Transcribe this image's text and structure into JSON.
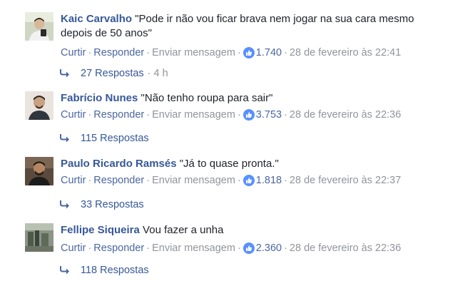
{
  "actions": {
    "like": "Curtir",
    "reply": "Responder",
    "message": "Enviar mensagem",
    "separator": "·"
  },
  "comments": [
    {
      "author": "Kaic Carvalho",
      "text_line1": "\"Pode ir não vou ficar brava nem jogar na sua cara mesmo",
      "text_line2": "depois de 50 anos\"",
      "likes": "1.740",
      "timestamp": "28 de fevereiro às 22:41",
      "replies": "27 Respostas",
      "reply_time": "· 4 h"
    },
    {
      "author": "Fabrício Nunes",
      "text_line1": "\"Não tenho roupa para sair\"",
      "likes": "3.753",
      "timestamp": "28 de fevereiro às 22:36",
      "replies": "115 Respostas"
    },
    {
      "author": "Paulo Ricardo Ramsés",
      "text_line1": "\"Já to quase pronta.\"",
      "likes": "1.818",
      "timestamp": "28 de fevereiro às 22:37",
      "replies": "33 Respostas"
    },
    {
      "author": "Fellipe Siqueira",
      "text_line1": "Vou fazer a unha",
      "likes": "2.360",
      "timestamp": "28 de fevereiro às 22:36",
      "replies": "118 Respostas"
    }
  ],
  "icons": {
    "like": "thumbs-up-icon",
    "reply": "reply-arrow-icon"
  },
  "colors": {
    "author": "#365899",
    "meta": "#90949c",
    "link": "#4b67a1",
    "like_badge": "#5890ff"
  }
}
